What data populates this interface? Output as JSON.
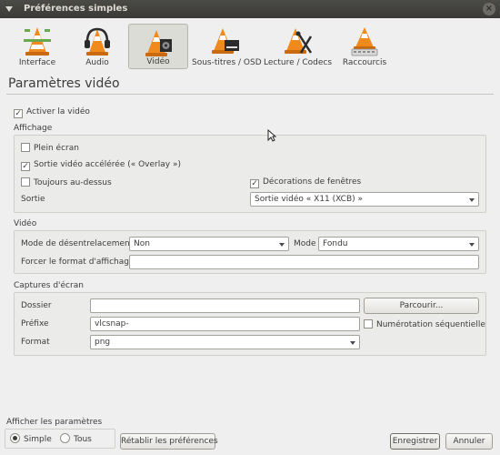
{
  "window": {
    "title": "Préférences simples",
    "close_glyph": "×"
  },
  "categories": [
    {
      "id": "interface",
      "label": "Interface",
      "icon": "cone-interface-icon"
    },
    {
      "id": "audio",
      "label": "Audio",
      "icon": "cone-headphones-icon"
    },
    {
      "id": "video",
      "label": "Vidéo",
      "icon": "cone-video-icon",
      "active": true
    },
    {
      "id": "subtitles",
      "label": "Sous-titres / OSD",
      "icon": "cone-subtitles-icon"
    },
    {
      "id": "input",
      "label": "Lecture / Codecs",
      "icon": "cone-codecs-icon"
    },
    {
      "id": "hotkeys",
      "label": "Raccourcis",
      "icon": "cone-hotkeys-icon"
    }
  ],
  "page_title": "Paramètres vidéo",
  "enable_video": {
    "label": "Activer la vidéo",
    "checked": true
  },
  "display": {
    "title": "Affichage",
    "fullscreen": {
      "label": "Plein écran",
      "checked": false
    },
    "overlay": {
      "label": "Sortie vidéo accélérée (« Overlay »)",
      "checked": true
    },
    "always_on_top": {
      "label": "Toujours au-dessus",
      "checked": false
    },
    "decorations": {
      "label": "Décorations de fenêtres",
      "checked": true
    },
    "output_label": "Sortie",
    "output_value": "Sortie vidéo « X11 (XCB) »"
  },
  "video": {
    "title": "Vidéo",
    "deinterlace_label": "Mode de désentrelacement",
    "deinterlace_value": "Non",
    "mode_label": "Mode",
    "mode_value": "Fondu",
    "aspect_label": "Forcer le format d'affichage",
    "aspect_value": ""
  },
  "snapshots": {
    "title": "Captures d'écran",
    "folder_label": "Dossier",
    "folder_value": "",
    "browse_label": "Parcourir...",
    "prefix_label": "Préfixe",
    "prefix_value": "vlcsnap-",
    "sequential_label": "Numérotation séquentielle",
    "sequential_checked": false,
    "format_label": "Format",
    "format_value": "png"
  },
  "footer": {
    "show_settings_label": "Afficher les paramètres",
    "simple_label": "Simple",
    "all_label": "Tous",
    "reset_label": "Rétablir les préférences",
    "save_label": "Enregistrer",
    "cancel_label": "Annuler"
  },
  "colors": {
    "cone_orange": "#f08a1c",
    "cone_white": "#ffffff",
    "titlebar": "#3b3a37",
    "active_tab": "#dcdcd6"
  }
}
